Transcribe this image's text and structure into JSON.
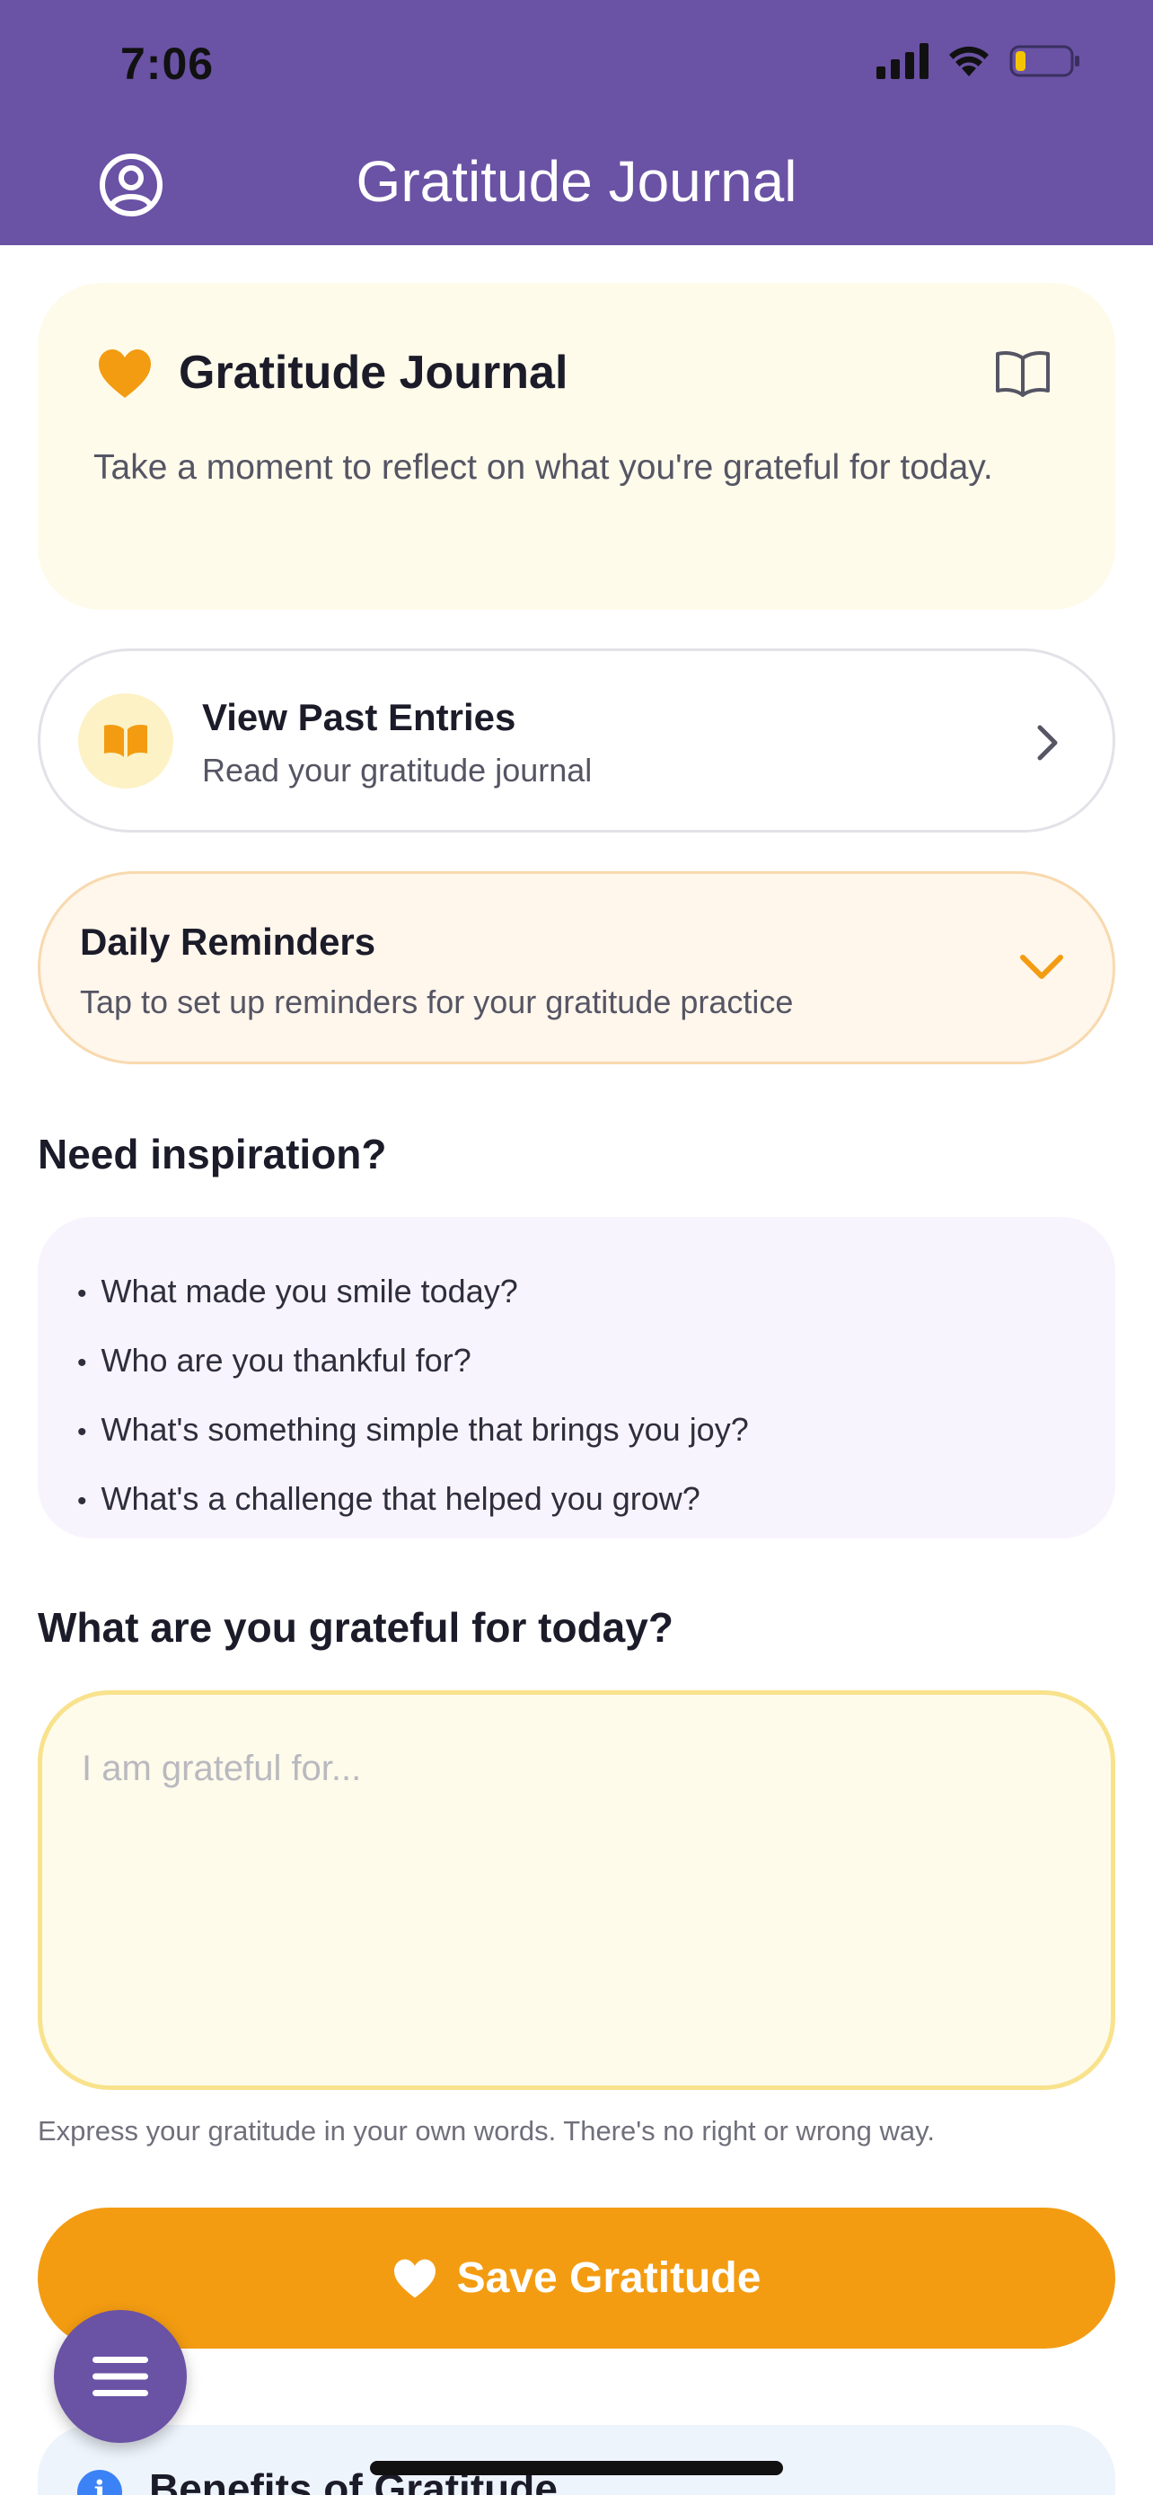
{
  "status_bar": {
    "time": "7:06"
  },
  "header": {
    "title": "Gratitude Journal",
    "profile_icon": "user-circle-icon"
  },
  "intro": {
    "title": "Gratitude Journal",
    "text": "Take a moment to reflect on what you're grateful for today.",
    "heart_icon": "heart-icon",
    "book_icon": "book-open-icon"
  },
  "past_entries": {
    "title": "View Past Entries",
    "subtitle": "Read your gratitude journal"
  },
  "reminders": {
    "title": "Daily Reminders",
    "subtitle": "Tap to set up reminders for your gratitude practice"
  },
  "inspiration": {
    "heading": "Need inspiration?",
    "prompts": [
      "What made you smile today?",
      "Who are you thankful for?",
      "What's something simple that brings you joy?",
      "What's a challenge that helped you grow?"
    ]
  },
  "entry": {
    "heading": "What are you grateful for today?",
    "placeholder": "I am grateful for...",
    "value": "",
    "helper": "Express your gratitude in your own words. There's no right or wrong way."
  },
  "save_button": {
    "label": "Save Gratitude"
  },
  "benefits": {
    "title": "Benefits of Gratitude"
  },
  "colors": {
    "header": "#6a52a5",
    "accent": "#f39c12",
    "intro_bg": "#fefbeb",
    "inspiration_bg": "#f8f4fd"
  }
}
